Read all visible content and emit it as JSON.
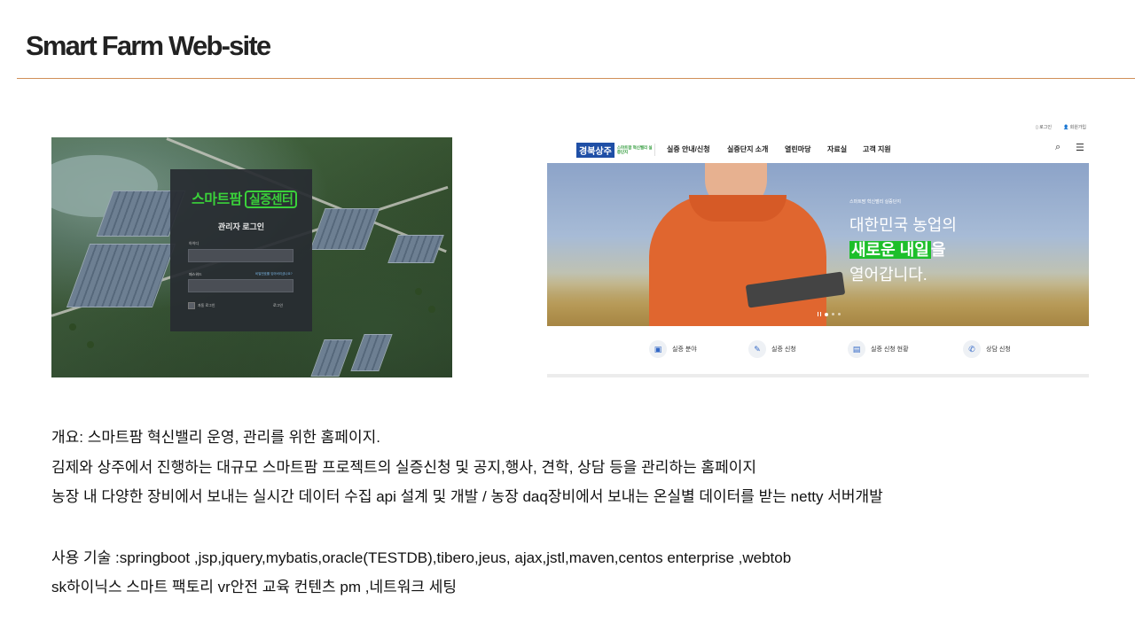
{
  "slide": {
    "title": "Smart Farm Web-site"
  },
  "login_screenshot": {
    "logo_text": "스마트팜",
    "logo_boxed": "실증센터",
    "heading": "관리자 로그인",
    "id_label": "아이디",
    "pw_label": "패스워드",
    "pw_link": "비밀번호를 잊어버리셨나요?",
    "auto_login": "자동 로그인",
    "login_button": "로그인"
  },
  "site_screenshot": {
    "util_login": "로그인",
    "util_join": "회원가입",
    "brand_main": "경북상주",
    "brand_sub": "스마트팜 혁신밸리 실증단지",
    "nav": [
      "실증 안내/신청",
      "실증단지 소개",
      "열린마당",
      "자료실",
      "고객 지원"
    ],
    "hero": {
      "small": "스마트팜 혁신밸리 실증단지",
      "line1": "대한민국 농업의",
      "highlight": "새로운 내일",
      "highlight_suffix": "을",
      "line3": "열어갑니다."
    },
    "quick_links": [
      "실증 분야",
      "실증 신청",
      "실증 신청 현황",
      "상담 신청"
    ]
  },
  "description": {
    "line1": "개요: 스마트팜 혁신밸리 운영, 관리를 위한 홈페이지.",
    "line2": "김제와 상주에서 진행하는 대규모 스마트팜 프로젝트의 실증신청 및 공지,행사, 견학, 상담 등을 관리하는 홈페이지",
    "line3": "농장 내 다양한 장비에서 보내는 실시간 데이터 수집 api 설계 및 개발 / 농장 daq장비에서 보내는 온실별 데이터를 받는 netty 서버개발",
    "tech": "사용 기술 :springboot ,jsp,jquery,mybatis,oracle(TESTDB),tibero,jeus, ajax,jstl,maven,centos enterprise ,webtob",
    "extra": "sk하이닉스 스마트 팩토리 vr안전 교육 컨텐츠 pm ,네트워크 세팅"
  },
  "colors": {
    "rule": "#d08f58",
    "brand_blue": "#1f4fa6",
    "hero_green": "#1dbf2a",
    "login_green": "#3ad13a"
  }
}
